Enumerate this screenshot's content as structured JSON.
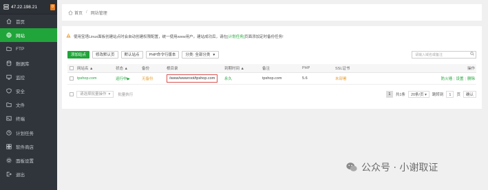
{
  "sidebar": {
    "server_ip": "47.22.198.21",
    "badge": "0",
    "items": [
      {
        "label": "首页",
        "icon": "home-icon",
        "active": false
      },
      {
        "label": "网站",
        "icon": "globe-icon",
        "active": true
      },
      {
        "label": "FTP",
        "icon": "ftp-icon",
        "active": false
      },
      {
        "label": "数据库",
        "icon": "database-icon",
        "active": false
      },
      {
        "label": "监控",
        "icon": "monitor-icon",
        "active": false
      },
      {
        "label": "安全",
        "icon": "shield-icon",
        "active": false
      },
      {
        "label": "文件",
        "icon": "folder-icon",
        "active": false
      },
      {
        "label": "终端",
        "icon": "terminal-icon",
        "active": false
      },
      {
        "label": "计划任务",
        "icon": "clock-icon",
        "active": false
      },
      {
        "label": "软件商店",
        "icon": "store-icon",
        "active": false
      },
      {
        "label": "面板设置",
        "icon": "gear-icon",
        "active": false
      },
      {
        "label": "退出",
        "icon": "logout-icon",
        "active": false
      }
    ]
  },
  "breadcrumb": {
    "home": "首页",
    "sep": "/",
    "current": "网站管理"
  },
  "warning": {
    "text_before": "使用宝塔Linux面板创建站点时会自动创建权限配置，统一使用www用户。建站成功后，请在",
    "link": "[计划任务]",
    "text_after": "页面添加定时备份任务!"
  },
  "toolbar": {
    "add_site": "添加站点",
    "default_page": "修改默认页",
    "default_site": "默认站点",
    "php_cli": "PHP命令行版本",
    "category": "分类: 全部分类",
    "search_placeholder": "请输入域名或备注"
  },
  "table": {
    "headers": [
      "网站名 ▲",
      "状态 ▲",
      "备份",
      "根目录",
      "到期时间 ▲",
      "备注",
      "PHP",
      "SSL证书",
      "操作"
    ],
    "rows": [
      {
        "name": "tpshop.com",
        "status": "运行中▶",
        "backup": "无备份",
        "root": "/www/wwwroot/tpshop.com",
        "expiry": "永久",
        "note": "tpshop.com",
        "php": "5.6",
        "ssl": "未部署",
        "ops": [
          "防火墙",
          "设置",
          "删除"
        ]
      }
    ]
  },
  "footer": {
    "bulk_select": "请选择批量操作",
    "bulk_exec": "批量执行",
    "page_current": "1",
    "total": "共1条",
    "per_page": "20条/页",
    "goto": "跳转到",
    "page_box": "1",
    "page_unit": "页",
    "confirm": "确认"
  },
  "watermark": {
    "text": "公众号 · 小谢取证"
  },
  "colors": {
    "accent": "#20a53a",
    "sidebar": "#30353c",
    "warning": "#e6a23c",
    "highlight_box": "#d9534f"
  }
}
